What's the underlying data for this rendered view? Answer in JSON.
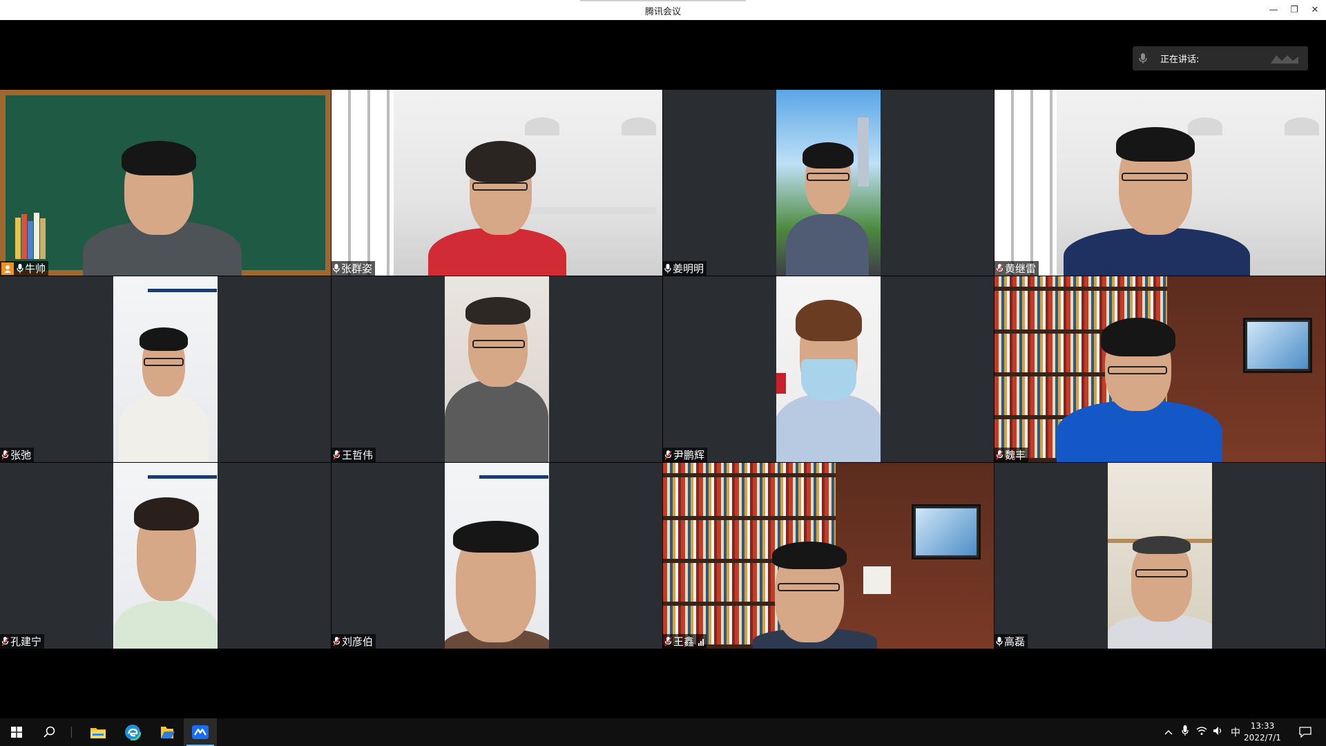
{
  "window": {
    "title": "腾讯会议",
    "minimize_label": "—",
    "maximize_label": "❐",
    "close_label": "✕"
  },
  "speaking": {
    "label": "正在讲话:"
  },
  "participants": [
    {
      "name": "牛帅",
      "host": true,
      "muted": false
    },
    {
      "name": "张群姿",
      "host": false,
      "muted": false
    },
    {
      "name": "姜明明",
      "host": false,
      "muted": false
    },
    {
      "name": "黄继雷",
      "host": false,
      "muted": true
    },
    {
      "name": "张弛",
      "host": false,
      "muted": true
    },
    {
      "name": "王哲伟",
      "host": false,
      "muted": true
    },
    {
      "name": "尹鹏辉",
      "host": false,
      "muted": true
    },
    {
      "name": "魏丰",
      "host": false,
      "muted": true
    },
    {
      "name": "孔建宁",
      "host": false,
      "muted": true
    },
    {
      "name": "刘彦伯",
      "host": false,
      "muted": true
    },
    {
      "name": "王鑫",
      "host": false,
      "muted": true,
      "speaking": true
    },
    {
      "name": "高磊",
      "host": false,
      "muted": false
    }
  ],
  "taskbar": {
    "icons": [
      "windows-start-icon",
      "search-icon",
      "file-explorer-icon",
      "edge-browser-icon",
      "file-manager-icon",
      "tencent-meeting-icon"
    ],
    "tray": {
      "ime": "中",
      "time": "13:33",
      "date": "2022/7/1"
    }
  },
  "colors": {
    "host_badge": "#f29021",
    "tile_bg": "#2a2d31",
    "chalkboard": "#1f5a45",
    "frame_wood": "#a0672e"
  }
}
